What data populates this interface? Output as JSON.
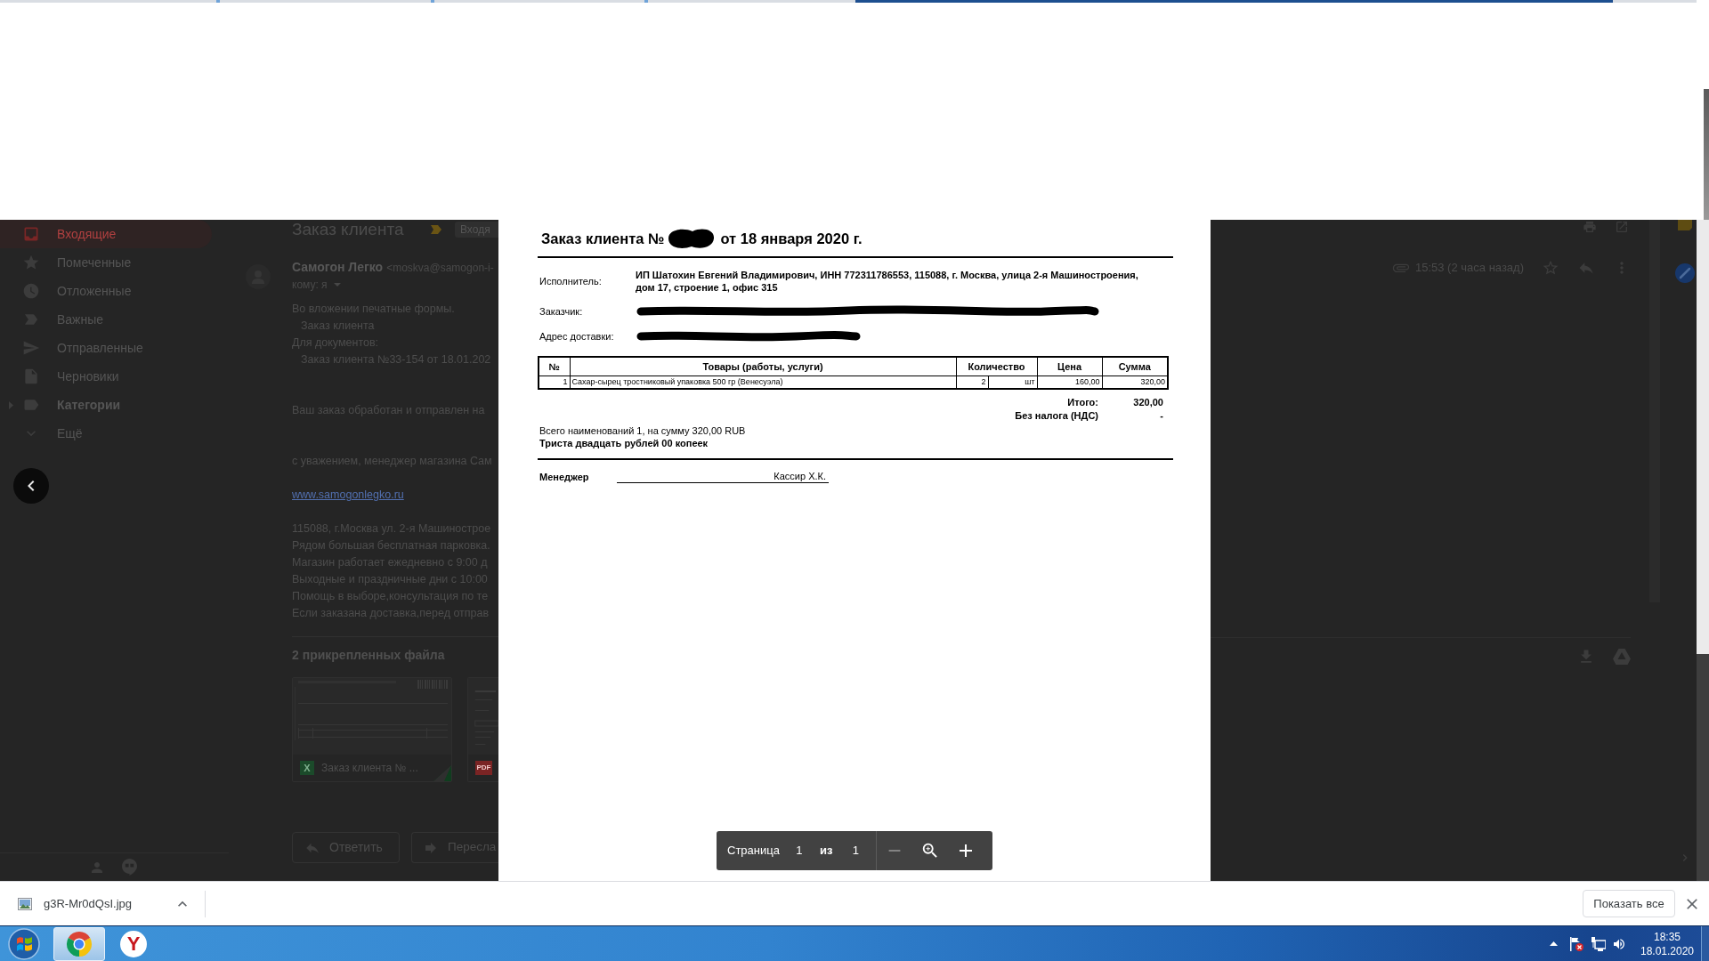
{
  "mail": {
    "sidebar": {
      "items": [
        {
          "label": "Входящие",
          "kind": "folder",
          "selected": true
        },
        {
          "label": "Помеченные",
          "kind": "folder",
          "selected": false
        },
        {
          "label": "Отложенные",
          "kind": "folder",
          "selected": false
        },
        {
          "label": "Важные",
          "kind": "folder",
          "selected": false
        },
        {
          "label": "Отправленные",
          "kind": "folder",
          "selected": false
        },
        {
          "label": "Черновики",
          "kind": "folder",
          "selected": false
        },
        {
          "label": "Категории",
          "kind": "group",
          "selected": false,
          "expanded": false
        },
        {
          "label": "Ещё",
          "kind": "more",
          "selected": false
        }
      ]
    },
    "message": {
      "subject": "Заказ клиента",
      "label": "Входя",
      "sender_name": "Самогон Легко",
      "sender_email": "<moskva@samogon-i-",
      "recipient": "кому: я",
      "time": "15:53 (2 часа назад)",
      "starred": false,
      "body": [
        {
          "kind": "list",
          "text": "Во вложении печатные формы.",
          "children": [
            {
              "text": "Заказ клиента"
            }
          ]
        },
        {
          "kind": "list",
          "text": "Для документов:",
          "children": [
            {
              "text": "Заказ клиента №33-154 от 18.01.202"
            }
          ]
        },
        {
          "kind": "paragraph",
          "text": "Ваш заказ обработан и отправлен на"
        },
        {
          "kind": "paragraph",
          "text": "с уважением, менеджер магазина Сам"
        },
        {
          "kind": "link",
          "text": "www.samogonlegko.ru"
        },
        {
          "kind": "address",
          "lines": [
            "115088, г.Москва ул. 2-я Машинострое",
            "Рядом большая бесплатная парковка.",
            "Магазин работает ежедневно с 9:00 д",
            "Выходные и праздничные дни с 10:00",
            "Помощь в выборе,консультация по те",
            "Если заказана доставка,перед отправ"
          ]
        }
      ],
      "attachments_title": "2 прикрепленных файла",
      "attachments": [
        {
          "kind": "spreadsheet",
          "badge": "X",
          "name": "Заказ клиента № ..."
        },
        {
          "kind": "pdf",
          "badge": "PDF"
        }
      ],
      "actions": [
        "Ответить",
        "Пересла"
      ]
    }
  },
  "viewer": {
    "document": {
      "title_prefix": "Заказ клиента №",
      "title_number_redacted": true,
      "title_suffix": "от 18 января 2020 г.",
      "parties": [
        {
          "label": "Исполнитель:",
          "value": "ИП Шатохин Евгений Владимирович, ИНН 772311786553, 115088, г. Москва, улица 2-я Машиностроения, дом 17, строение 1, офис 315",
          "redacted": false
        },
        {
          "label": "Заказчик:",
          "redacted": true
        },
        {
          "label": "Адрес доставки:",
          "redacted": true
        }
      ],
      "table": {
        "columns": [
          {
            "label": "№"
          },
          {
            "label": "Товары (работы, услуги)"
          },
          {
            "label": "Количество",
            "colspan": 2
          },
          {
            "label": "Цена"
          },
          {
            "label": "Сумма"
          }
        ],
        "rows": [
          {
            "cells": [
              "1",
              "Сахар-сырец тростниковый упаковка 500 гр (Венесуэла)",
              "2",
              "шт",
              "160,00",
              "320,00"
            ]
          }
        ]
      },
      "totals": [
        {
          "label": "Итого:",
          "value": "320,00"
        },
        {
          "label": "Без налога (НДС)",
          "value": "-"
        }
      ],
      "summary": "Всего наименований 1, на сумму 320,00 RUB",
      "amount_in_words": "Триста двадцать рублей 00 копеек",
      "signature": {
        "role": "Менеджер",
        "name": "Кассир Х.К."
      }
    },
    "pager": {
      "label": "Страница",
      "page": "1",
      "of": "из",
      "total": "1",
      "zoom_out_disabled": true
    }
  },
  "downloads": {
    "file": "g3R-Mr0dQsI.jpg",
    "show_all": "Показать все"
  },
  "taskbar": {
    "apps": [
      {
        "kind": "chrome",
        "active": true
      },
      {
        "kind": "yandex",
        "glyph": "Y",
        "active": false
      }
    ],
    "clock": {
      "time": "18:35",
      "date": "18.01.2020"
    }
  }
}
